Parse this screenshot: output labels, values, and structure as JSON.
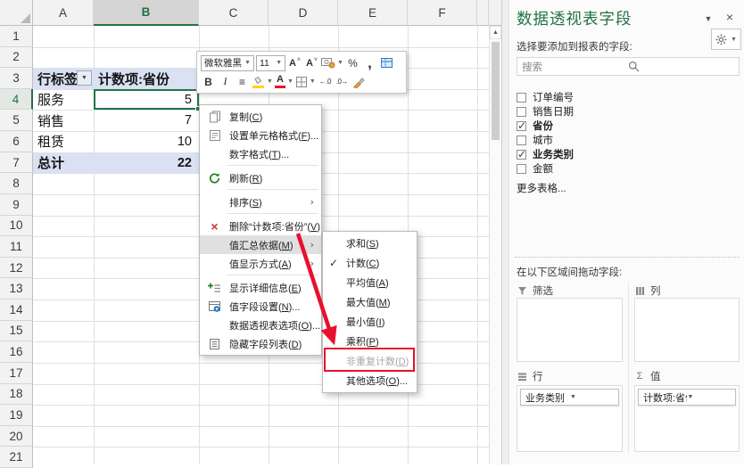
{
  "sheet": {
    "column_headers": [
      "A",
      "B",
      "C",
      "D",
      "E",
      "F"
    ],
    "row_headers": [
      "1",
      "2",
      "3",
      "4",
      "5",
      "6",
      "7",
      "8",
      "9",
      "10",
      "11",
      "12",
      "13",
      "14",
      "15",
      "16",
      "17",
      "18",
      "19",
      "20",
      "21"
    ],
    "selected_column": "B",
    "selected_row": "4",
    "pivot": {
      "row_label_header": "行标签",
      "value_header": "计数项:省份",
      "rows": [
        {
          "label": "服务",
          "value": "5"
        },
        {
          "label": "销售",
          "value": "7"
        },
        {
          "label": "租赁",
          "value": "10"
        }
      ],
      "total_label": "总计",
      "total_value": "22"
    }
  },
  "mini_toolbar": {
    "row1": [
      {
        "name": "font-name-select",
        "glyph": "微软雅黑",
        "type": "combo",
        "width": 60
      },
      {
        "name": "font-size-select",
        "glyph": "11",
        "type": "combo",
        "width": 33
      },
      {
        "name": "grow-font-button",
        "glyph": "A",
        "mark": "^"
      },
      {
        "name": "shrink-font-button",
        "glyph": "A",
        "mark": "v"
      },
      {
        "name": "accounting-format-button",
        "glyph": "",
        "dropdown": true
      },
      {
        "name": "percent-style-button",
        "glyph": "%"
      },
      {
        "name": "comma-style-button",
        "glyph": ","
      },
      {
        "name": "table-style-button",
        "glyph": ""
      }
    ],
    "row2": [
      {
        "name": "bold-button",
        "glyph": "B"
      },
      {
        "name": "italic-button",
        "glyph": "I"
      },
      {
        "name": "center-button",
        "glyph": "≡"
      },
      {
        "name": "fill-color-button",
        "glyph": "",
        "dropdown": true
      },
      {
        "name": "font-color-button",
        "glyph": "A",
        "dropdown": true
      },
      {
        "name": "borders-button",
        "glyph": "",
        "dropdown": true
      },
      {
        "name": "increase-decimal-button",
        "glyph": "←.0"
      },
      {
        "name": "decrease-decimal-button",
        "glyph": ".0→"
      },
      {
        "name": "format-painter-button",
        "glyph": ""
      }
    ]
  },
  "context_menu": {
    "items": [
      {
        "label": "复制(C)",
        "icon": "copy-icon"
      },
      {
        "label": "设置单元格格式(F)...",
        "icon": "format-cells-icon"
      },
      {
        "label": "数字格式(T)...",
        "divider_after": true
      },
      {
        "label": "刷新(R)",
        "icon": "refresh-icon",
        "divider_after": true
      },
      {
        "label": "排序(S)",
        "submenu": true,
        "divider_after": true
      },
      {
        "label": "删除“计数项:省份”(V)",
        "icon": "delete-icon"
      },
      {
        "label": "值汇总依据(M)",
        "submenu": true,
        "highlighted": true
      },
      {
        "label": "值显示方式(A)",
        "submenu": true,
        "divider_after": true
      },
      {
        "label": "显示详细信息(E)",
        "icon": "show-details-icon"
      },
      {
        "label": "值字段设置(N)...",
        "icon": "field-settings-icon"
      },
      {
        "label": "数据透视表选项(O)..."
      },
      {
        "label": "隐藏字段列表(D)",
        "icon": "field-list-icon"
      }
    ]
  },
  "submenu": {
    "items": [
      {
        "label": "求和(S)"
      },
      {
        "label": "计数(C)",
        "checked": true
      },
      {
        "label": "平均值(A)"
      },
      {
        "label": "最大值(M)"
      },
      {
        "label": "最小值(I)"
      },
      {
        "label": "乘积(P)"
      },
      {
        "label": "非重复计数(D)",
        "disabled": true,
        "highlight_box": true
      },
      {
        "label": "其他选项(O)..."
      }
    ]
  },
  "panel": {
    "title": "数据透视表字段",
    "subtitle": "选择要添加到报表的字段:",
    "search": {
      "placeholder": "搜索"
    },
    "fields": [
      {
        "label": "订单编号",
        "checked": false
      },
      {
        "label": "销售日期",
        "checked": false
      },
      {
        "label": "省份",
        "checked": true
      },
      {
        "label": "城市",
        "checked": false
      },
      {
        "label": "业务类别",
        "checked": true
      },
      {
        "label": "金额",
        "checked": false
      }
    ],
    "more_tables_label": "更多表格...",
    "drag_hint": "在以下区域间拖动字段:",
    "areas": [
      {
        "id": "filters",
        "label": "筛选",
        "icon": "funnel-icon",
        "items": []
      },
      {
        "id": "columns",
        "label": "列",
        "icon": "columns-icon",
        "items": []
      },
      {
        "id": "rows",
        "label": "行",
        "icon": "rows-icon",
        "items": [
          "业务类别"
        ]
      },
      {
        "id": "values",
        "label": "值",
        "icon": "sigma-icon",
        "items": [
          "计数项:省份"
        ]
      }
    ]
  },
  "colors": {
    "excel_green": "#217346",
    "pivot_header_bg": "#D9E1F2",
    "annotation_red": "#E8112D",
    "menu_highlight": "#E0E0E0"
  }
}
